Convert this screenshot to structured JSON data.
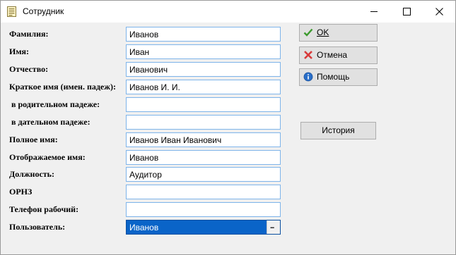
{
  "window": {
    "title": "Сотрудник",
    "icon": "document-icon"
  },
  "titlebar_buttons": {
    "minimize": "minimize-icon",
    "maximize": "maximize-icon",
    "close": "close-icon"
  },
  "form": {
    "fields": [
      {
        "label": "Фамилия:",
        "value": "Иванов"
      },
      {
        "label": "Имя:",
        "value": "Иван"
      },
      {
        "label": "Отчество:",
        "value": "Иванович"
      },
      {
        "label": "Краткое имя (имен. падеж):",
        "value": "Иванов И. И."
      },
      {
        "label": " в родительном падеже:",
        "value": ""
      },
      {
        "label": " в дательном падеже:",
        "value": ""
      },
      {
        "label": "Полное имя:",
        "value": "Иванов Иван Иванович"
      },
      {
        "label": "Отображаемое имя:",
        "value": "Иванов"
      },
      {
        "label": "Должность:",
        "value": "Аудитор"
      },
      {
        "label": "ОРНЗ",
        "value": ""
      },
      {
        "label": "Телефон рабочий:",
        "value": ""
      },
      {
        "label": "Пользователь:",
        "value": "Иванов",
        "ellipsis": "..."
      }
    ]
  },
  "buttons": {
    "ok": {
      "label": "OK",
      "icon": "checkmark-icon"
    },
    "cancel": {
      "label": "Отмена",
      "icon": "x-icon"
    },
    "help": {
      "label": "Помощь",
      "icon": "info-icon"
    },
    "history": {
      "label": "История"
    }
  },
  "colors": {
    "selection": "#0a64c8",
    "field_border": "#7eb4ea",
    "ok_green": "#3c9a2e",
    "cancel_red": "#d83a3a",
    "info_blue": "#2a6fc9"
  }
}
